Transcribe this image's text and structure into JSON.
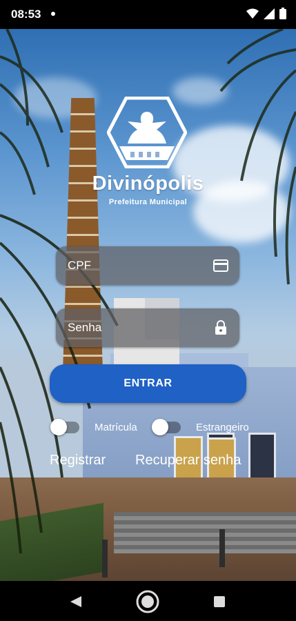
{
  "statusbar": {
    "time": "08:53"
  },
  "brand": {
    "name": "Divinópolis",
    "subtitle": "Prefeitura Municipal"
  },
  "form": {
    "cpf": {
      "placeholder": "CPF",
      "value": ""
    },
    "senha": {
      "placeholder": "Senha",
      "value": ""
    },
    "submit_label": "ENTRAR"
  },
  "options": [
    {
      "label": "Matrícula",
      "on": false
    },
    {
      "label": "Estrangeiro",
      "on": false
    }
  ],
  "links": {
    "register": "Registrar",
    "recover": "Recuperar senha"
  },
  "icons": {
    "cpf": "card-icon",
    "senha": "lock-icon",
    "status": [
      "wifi-icon",
      "signal-icon",
      "battery-icon"
    ],
    "nav": [
      "back-icon",
      "home-icon",
      "recents-icon"
    ]
  },
  "colors": {
    "accent": "#1f61c4",
    "field": "#5f5f64",
    "background_sky": "#5b95cf"
  }
}
